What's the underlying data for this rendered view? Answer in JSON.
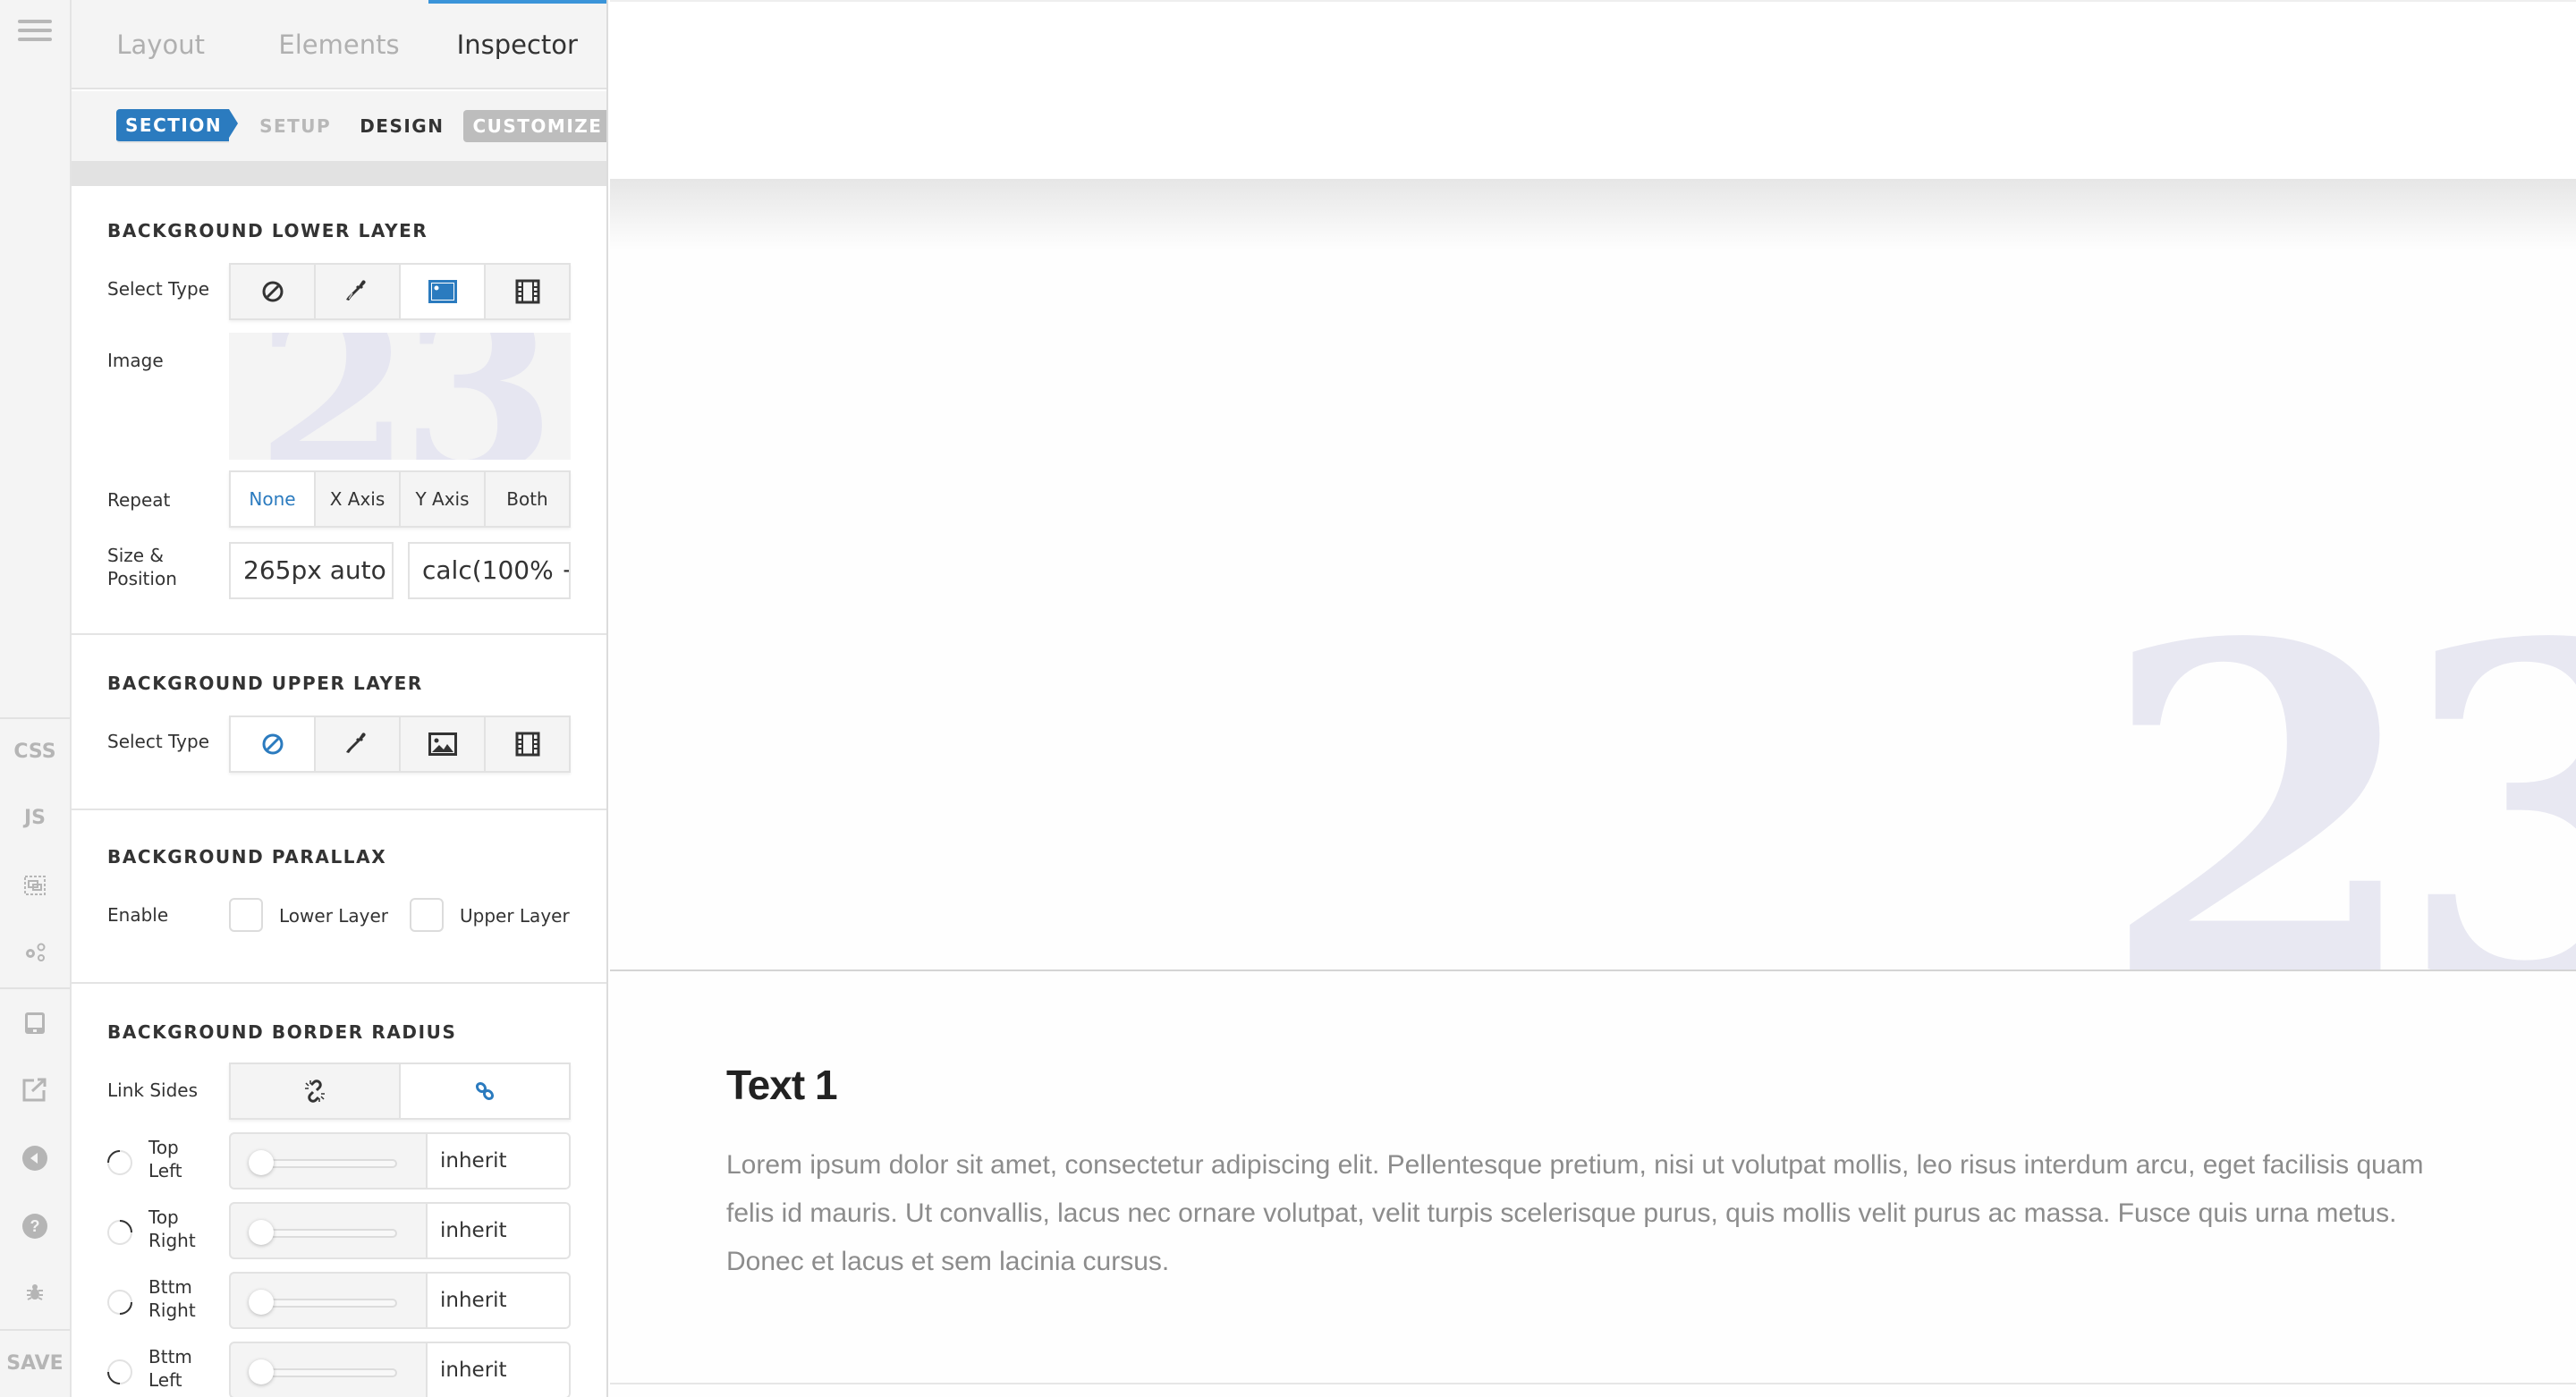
{
  "rail": {
    "items": [
      {
        "label": "CSS",
        "icon": "css-icon"
      },
      {
        "label": "JS",
        "icon": "js-icon"
      },
      {
        "label": "",
        "icon": "layout-select-icon"
      },
      {
        "label": "",
        "icon": "settings-icon"
      },
      {
        "label": "",
        "icon": "responsive-icon"
      },
      {
        "label": "",
        "icon": "external-link-icon"
      },
      {
        "label": "",
        "icon": "back-icon"
      },
      {
        "label": "",
        "icon": "help-icon"
      },
      {
        "label": "",
        "icon": "bug-icon"
      }
    ],
    "save_label": "SAVE"
  },
  "panel": {
    "tabs": [
      {
        "label": "Layout",
        "active": false
      },
      {
        "label": "Elements",
        "active": false
      },
      {
        "label": "Inspector",
        "active": true
      }
    ],
    "crumbs": {
      "section": "SECTION",
      "setup": "SETUP",
      "design": "DESIGN",
      "customize": "CUSTOMIZE"
    },
    "lower_layer": {
      "title": "BACKGROUND LOWER LAYER",
      "select_type_label": "Select Type",
      "types": [
        "none-icon",
        "color-picker-icon",
        "image-icon",
        "video-icon"
      ],
      "selected_type": "image",
      "image_label": "Image",
      "image_preview_text": "23",
      "repeat_label": "Repeat",
      "repeat_options": [
        "None",
        "X Axis",
        "Y Axis",
        "Both"
      ],
      "repeat_selected": "None",
      "size_position_label": "Size & Position",
      "size_value": "265px auto",
      "position_value": "calc(100% +"
    },
    "upper_layer": {
      "title": "BACKGROUND UPPER LAYER",
      "select_type_label": "Select Type",
      "types": [
        "none-icon",
        "color-picker-icon",
        "image-icon",
        "video-icon"
      ],
      "selected_type": "none"
    },
    "parallax": {
      "title": "BACKGROUND PARALLAX",
      "enable_label": "Enable",
      "lower_label": "Lower Layer",
      "upper_label": "Upper Layer",
      "lower_checked": false,
      "upper_checked": false
    },
    "border_radius": {
      "title": "BACKGROUND BORDER RADIUS",
      "link_sides_label": "Link Sides",
      "linked": true,
      "corners": [
        {
          "label_1": "Top",
          "label_2": "Left",
          "value": "inherit",
          "slider": 0
        },
        {
          "label_1": "Top",
          "label_2": "Right",
          "value": "inherit",
          "slider": 0
        },
        {
          "label_1": "Bttm",
          "label_2": "Right",
          "value": "inherit",
          "slider": 0
        },
        {
          "label_1": "Bttm",
          "label_2": "Left",
          "value": "inherit",
          "slider": 0
        }
      ]
    }
  },
  "preview": {
    "hero_number": "23",
    "text_title": "Text 1",
    "text_body": "Lorem ipsum dolor sit amet, consectetur adipiscing elit. Pellentesque pretium, nisi ut volutpat mollis, leo risus interdum arcu, eget facilisis quam felis id mauris. Ut convallis, lacus nec ornare volutpat, velit turpis scelerisque purus, quis mollis velit purus ac massa. Fusce quis urna metus. Donec et lacus et sem lacinia cursus."
  },
  "colors": {
    "accent": "#2b7bbf",
    "tab_indicator": "#3a94d9",
    "ghost_number": "#e8e8f2"
  }
}
